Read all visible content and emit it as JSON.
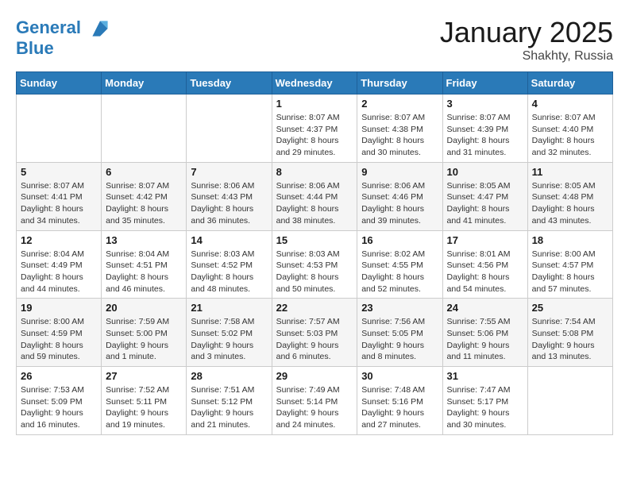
{
  "header": {
    "logo_line1": "General",
    "logo_line2": "Blue",
    "month": "January 2025",
    "location": "Shakhty, Russia"
  },
  "weekdays": [
    "Sunday",
    "Monday",
    "Tuesday",
    "Wednesday",
    "Thursday",
    "Friday",
    "Saturday"
  ],
  "weeks": [
    [
      {
        "day": "",
        "info": ""
      },
      {
        "day": "",
        "info": ""
      },
      {
        "day": "",
        "info": ""
      },
      {
        "day": "1",
        "info": "Sunrise: 8:07 AM\nSunset: 4:37 PM\nDaylight: 8 hours and 29 minutes."
      },
      {
        "day": "2",
        "info": "Sunrise: 8:07 AM\nSunset: 4:38 PM\nDaylight: 8 hours and 30 minutes."
      },
      {
        "day": "3",
        "info": "Sunrise: 8:07 AM\nSunset: 4:39 PM\nDaylight: 8 hours and 31 minutes."
      },
      {
        "day": "4",
        "info": "Sunrise: 8:07 AM\nSunset: 4:40 PM\nDaylight: 8 hours and 32 minutes."
      }
    ],
    [
      {
        "day": "5",
        "info": "Sunrise: 8:07 AM\nSunset: 4:41 PM\nDaylight: 8 hours and 34 minutes."
      },
      {
        "day": "6",
        "info": "Sunrise: 8:07 AM\nSunset: 4:42 PM\nDaylight: 8 hours and 35 minutes."
      },
      {
        "day": "7",
        "info": "Sunrise: 8:06 AM\nSunset: 4:43 PM\nDaylight: 8 hours and 36 minutes."
      },
      {
        "day": "8",
        "info": "Sunrise: 8:06 AM\nSunset: 4:44 PM\nDaylight: 8 hours and 38 minutes."
      },
      {
        "day": "9",
        "info": "Sunrise: 8:06 AM\nSunset: 4:46 PM\nDaylight: 8 hours and 39 minutes."
      },
      {
        "day": "10",
        "info": "Sunrise: 8:05 AM\nSunset: 4:47 PM\nDaylight: 8 hours and 41 minutes."
      },
      {
        "day": "11",
        "info": "Sunrise: 8:05 AM\nSunset: 4:48 PM\nDaylight: 8 hours and 43 minutes."
      }
    ],
    [
      {
        "day": "12",
        "info": "Sunrise: 8:04 AM\nSunset: 4:49 PM\nDaylight: 8 hours and 44 minutes."
      },
      {
        "day": "13",
        "info": "Sunrise: 8:04 AM\nSunset: 4:51 PM\nDaylight: 8 hours and 46 minutes."
      },
      {
        "day": "14",
        "info": "Sunrise: 8:03 AM\nSunset: 4:52 PM\nDaylight: 8 hours and 48 minutes."
      },
      {
        "day": "15",
        "info": "Sunrise: 8:03 AM\nSunset: 4:53 PM\nDaylight: 8 hours and 50 minutes."
      },
      {
        "day": "16",
        "info": "Sunrise: 8:02 AM\nSunset: 4:55 PM\nDaylight: 8 hours and 52 minutes."
      },
      {
        "day": "17",
        "info": "Sunrise: 8:01 AM\nSunset: 4:56 PM\nDaylight: 8 hours and 54 minutes."
      },
      {
        "day": "18",
        "info": "Sunrise: 8:00 AM\nSunset: 4:57 PM\nDaylight: 8 hours and 57 minutes."
      }
    ],
    [
      {
        "day": "19",
        "info": "Sunrise: 8:00 AM\nSunset: 4:59 PM\nDaylight: 8 hours and 59 minutes."
      },
      {
        "day": "20",
        "info": "Sunrise: 7:59 AM\nSunset: 5:00 PM\nDaylight: 9 hours and 1 minute."
      },
      {
        "day": "21",
        "info": "Sunrise: 7:58 AM\nSunset: 5:02 PM\nDaylight: 9 hours and 3 minutes."
      },
      {
        "day": "22",
        "info": "Sunrise: 7:57 AM\nSunset: 5:03 PM\nDaylight: 9 hours and 6 minutes."
      },
      {
        "day": "23",
        "info": "Sunrise: 7:56 AM\nSunset: 5:05 PM\nDaylight: 9 hours and 8 minutes."
      },
      {
        "day": "24",
        "info": "Sunrise: 7:55 AM\nSunset: 5:06 PM\nDaylight: 9 hours and 11 minutes."
      },
      {
        "day": "25",
        "info": "Sunrise: 7:54 AM\nSunset: 5:08 PM\nDaylight: 9 hours and 13 minutes."
      }
    ],
    [
      {
        "day": "26",
        "info": "Sunrise: 7:53 AM\nSunset: 5:09 PM\nDaylight: 9 hours and 16 minutes."
      },
      {
        "day": "27",
        "info": "Sunrise: 7:52 AM\nSunset: 5:11 PM\nDaylight: 9 hours and 19 minutes."
      },
      {
        "day": "28",
        "info": "Sunrise: 7:51 AM\nSunset: 5:12 PM\nDaylight: 9 hours and 21 minutes."
      },
      {
        "day": "29",
        "info": "Sunrise: 7:49 AM\nSunset: 5:14 PM\nDaylight: 9 hours and 24 minutes."
      },
      {
        "day": "30",
        "info": "Sunrise: 7:48 AM\nSunset: 5:16 PM\nDaylight: 9 hours and 27 minutes."
      },
      {
        "day": "31",
        "info": "Sunrise: 7:47 AM\nSunset: 5:17 PM\nDaylight: 9 hours and 30 minutes."
      },
      {
        "day": "",
        "info": ""
      }
    ]
  ]
}
